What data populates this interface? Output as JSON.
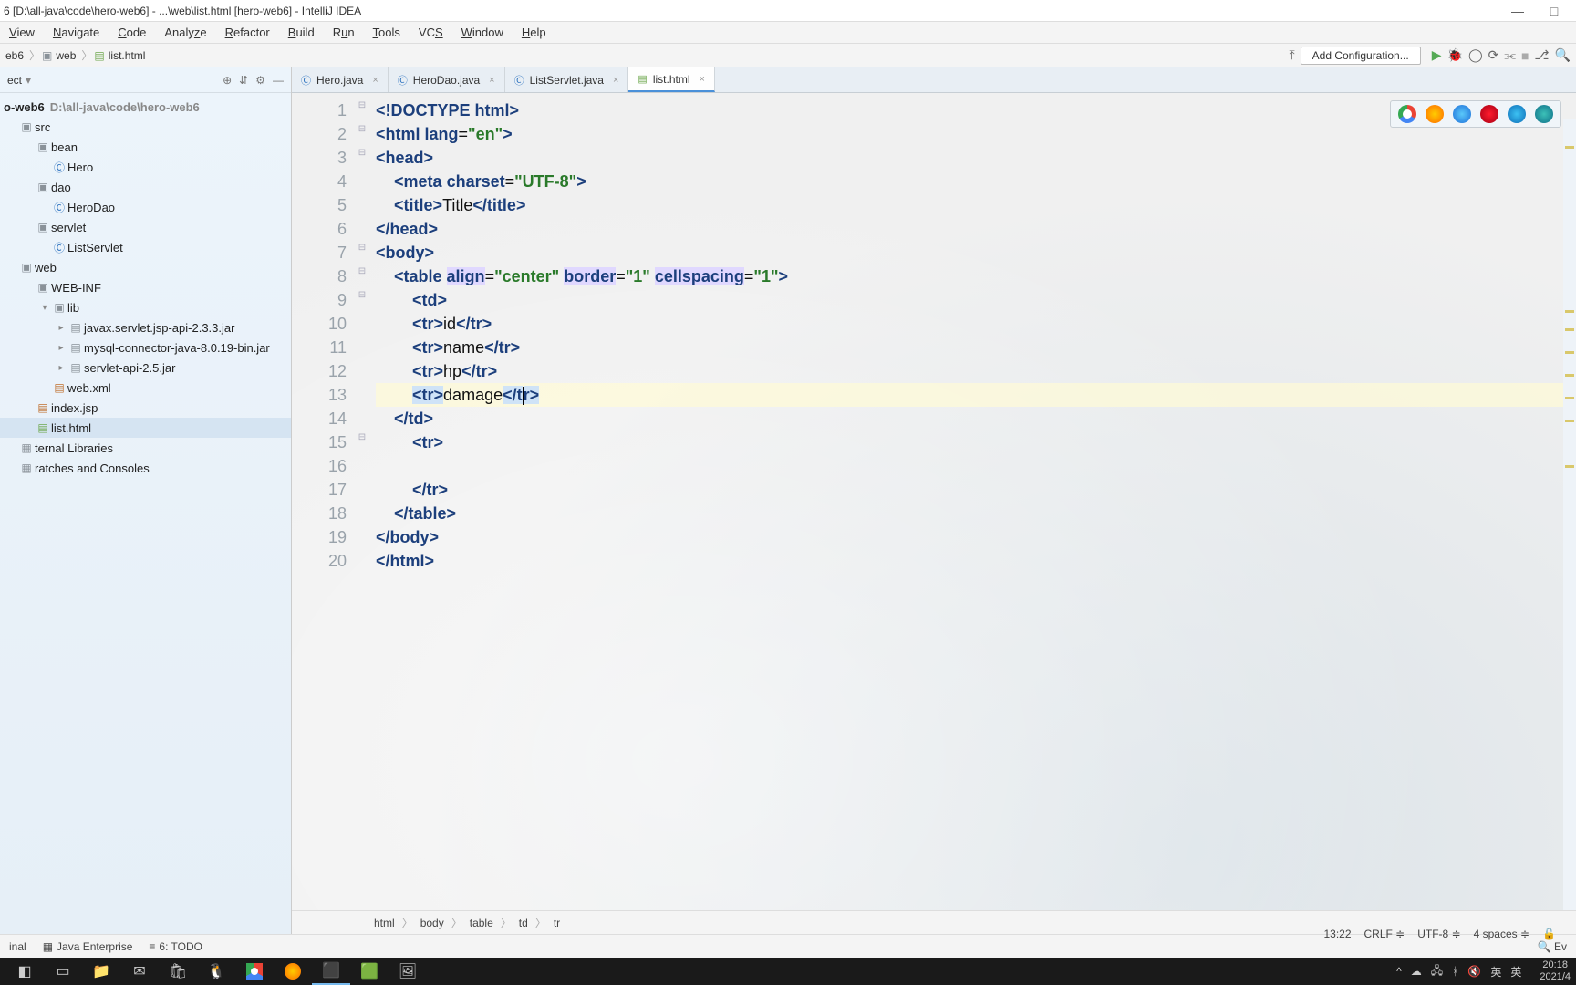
{
  "window": {
    "title": "6 [D:\\all-java\\code\\hero-web6] - ...\\web\\list.html [hero-web6] - IntelliJ IDEA"
  },
  "menu": [
    "View",
    "Navigate",
    "Code",
    "Analyze",
    "Refactor",
    "Build",
    "Run",
    "Tools",
    "VCS",
    "Window",
    "Help"
  ],
  "navcrumbs": [
    {
      "label": "eb6",
      "icon": ""
    },
    {
      "label": "web",
      "icon": "folder"
    },
    {
      "label": "list.html",
      "icon": "html"
    }
  ],
  "add_config": "Add Configuration...",
  "sidebar": {
    "header": "ect",
    "project_root": {
      "name": "o-web6",
      "path": "D:\\all-java\\code\\hero-web6"
    },
    "tree": [
      {
        "depth": 0,
        "arrow": "",
        "icon": "folder",
        "label": "src"
      },
      {
        "depth": 1,
        "arrow": "",
        "icon": "folder",
        "label": "bean"
      },
      {
        "depth": 2,
        "arrow": "",
        "icon": "java",
        "label": "Hero"
      },
      {
        "depth": 1,
        "arrow": "",
        "icon": "folder",
        "label": "dao"
      },
      {
        "depth": 2,
        "arrow": "",
        "icon": "java",
        "label": "HeroDao"
      },
      {
        "depth": 1,
        "arrow": "",
        "icon": "folder",
        "label": "servlet"
      },
      {
        "depth": 2,
        "arrow": "",
        "icon": "java",
        "label": "ListServlet"
      },
      {
        "depth": 0,
        "arrow": "",
        "icon": "folder",
        "label": "web"
      },
      {
        "depth": 1,
        "arrow": "",
        "icon": "folder",
        "label": "WEB-INF"
      },
      {
        "depth": 2,
        "arrow": "▾",
        "icon": "folder",
        "label": "lib"
      },
      {
        "depth": 3,
        "arrow": "▸",
        "icon": "jar",
        "label": "javax.servlet.jsp-api-2.3.3.jar"
      },
      {
        "depth": 3,
        "arrow": "▸",
        "icon": "jar",
        "label": "mysql-connector-java-8.0.19-bin.jar"
      },
      {
        "depth": 3,
        "arrow": "▸",
        "icon": "jar",
        "label": "servlet-api-2.5.jar"
      },
      {
        "depth": 2,
        "arrow": "",
        "icon": "xml",
        "label": "web.xml"
      },
      {
        "depth": 1,
        "arrow": "",
        "icon": "jsp",
        "label": "index.jsp"
      },
      {
        "depth": 1,
        "arrow": "",
        "icon": "html",
        "label": "list.html",
        "selected": true
      },
      {
        "depth": 0,
        "arrow": "",
        "icon": "lib",
        "label": "ternal Libraries"
      },
      {
        "depth": 0,
        "arrow": "",
        "icon": "scratch",
        "label": "ratches and Consoles"
      }
    ]
  },
  "tabs": [
    {
      "icon": "java",
      "label": "Hero.java",
      "active": false
    },
    {
      "icon": "java",
      "label": "HeroDao.java",
      "active": false
    },
    {
      "icon": "java",
      "label": "ListServlet.java",
      "active": false
    },
    {
      "icon": "html",
      "label": "list.html",
      "active": true
    }
  ],
  "code": {
    "lines": [
      {
        "n": 1,
        "tokens": [
          {
            "t": "<!",
            "c": "tag"
          },
          {
            "t": "DOCTYPE ",
            "c": "tag"
          },
          {
            "t": "html",
            "c": "attr"
          },
          {
            "t": ">",
            "c": "tag"
          }
        ]
      },
      {
        "n": 2,
        "tokens": [
          {
            "t": "<",
            "c": "tag"
          },
          {
            "t": "html ",
            "c": "tag"
          },
          {
            "t": "lang",
            "c": "attr"
          },
          {
            "t": "=",
            "c": "txt"
          },
          {
            "t": "\"en\"",
            "c": "str"
          },
          {
            "t": ">",
            "c": "tag"
          }
        ]
      },
      {
        "n": 3,
        "tokens": [
          {
            "t": "<",
            "c": "tag"
          },
          {
            "t": "head",
            "c": "tag"
          },
          {
            "t": ">",
            "c": "tag"
          }
        ]
      },
      {
        "n": 4,
        "indent": 1,
        "tokens": [
          {
            "t": "<",
            "c": "tag"
          },
          {
            "t": "meta ",
            "c": "tag"
          },
          {
            "t": "charset",
            "c": "attr"
          },
          {
            "t": "=",
            "c": "txt"
          },
          {
            "t": "\"UTF-8\"",
            "c": "str"
          },
          {
            "t": ">",
            "c": "tag"
          }
        ]
      },
      {
        "n": 5,
        "indent": 1,
        "tokens": [
          {
            "t": "<",
            "c": "tag"
          },
          {
            "t": "title",
            "c": "tag"
          },
          {
            "t": ">",
            "c": "tag"
          },
          {
            "t": "Title",
            "c": "txt"
          },
          {
            "t": "</",
            "c": "tag"
          },
          {
            "t": "title",
            "c": "tag"
          },
          {
            "t": ">",
            "c": "tag"
          }
        ]
      },
      {
        "n": 6,
        "tokens": [
          {
            "t": "</",
            "c": "tag"
          },
          {
            "t": "head",
            "c": "tag"
          },
          {
            "t": ">",
            "c": "tag"
          }
        ]
      },
      {
        "n": 7,
        "tokens": [
          {
            "t": "<",
            "c": "tag"
          },
          {
            "t": "body",
            "c": "tag"
          },
          {
            "t": ">",
            "c": "tag"
          }
        ]
      },
      {
        "n": 8,
        "indent": 1,
        "tokens": [
          {
            "t": "<",
            "c": "tag"
          },
          {
            "t": "table ",
            "c": "tag"
          },
          {
            "t": "align",
            "c": "attr attr-hl"
          },
          {
            "t": "=",
            "c": "txt"
          },
          {
            "t": "\"center\"",
            "c": "str"
          },
          {
            "t": " ",
            "c": "txt"
          },
          {
            "t": "border",
            "c": "attr attr-hl"
          },
          {
            "t": "=",
            "c": "txt"
          },
          {
            "t": "\"1\"",
            "c": "str"
          },
          {
            "t": " ",
            "c": "txt"
          },
          {
            "t": "cellspacing",
            "c": "attr attr-hl"
          },
          {
            "t": "=",
            "c": "txt"
          },
          {
            "t": "\"1\"",
            "c": "str"
          },
          {
            "t": ">",
            "c": "tag"
          }
        ]
      },
      {
        "n": 9,
        "indent": 2,
        "tokens": [
          {
            "t": "<",
            "c": "tag"
          },
          {
            "t": "td",
            "c": "tag"
          },
          {
            "t": ">",
            "c": "tag"
          }
        ]
      },
      {
        "n": 10,
        "indent": 2,
        "tokens": [
          {
            "t": "<",
            "c": "tag"
          },
          {
            "t": "tr",
            "c": "tag"
          },
          {
            "t": ">",
            "c": "tag"
          },
          {
            "t": "id",
            "c": "txt"
          },
          {
            "t": "</",
            "c": "tag"
          },
          {
            "t": "tr",
            "c": "tag"
          },
          {
            "t": ">",
            "c": "tag"
          }
        ]
      },
      {
        "n": 11,
        "indent": 2,
        "tokens": [
          {
            "t": "<",
            "c": "tag"
          },
          {
            "t": "tr",
            "c": "tag"
          },
          {
            "t": ">",
            "c": "tag"
          },
          {
            "t": "name",
            "c": "txt"
          },
          {
            "t": "</",
            "c": "tag"
          },
          {
            "t": "tr",
            "c": "tag"
          },
          {
            "t": ">",
            "c": "tag"
          }
        ]
      },
      {
        "n": 12,
        "indent": 2,
        "tokens": [
          {
            "t": "<",
            "c": "tag"
          },
          {
            "t": "tr",
            "c": "tag"
          },
          {
            "t": ">",
            "c": "tag"
          },
          {
            "t": "hp",
            "c": "txt"
          },
          {
            "t": "</",
            "c": "tag"
          },
          {
            "t": "tr",
            "c": "tag"
          },
          {
            "t": ">",
            "c": "tag"
          }
        ]
      },
      {
        "n": 13,
        "indent": 2,
        "hl": true,
        "tokens": [
          {
            "t": "<",
            "c": "tag sel-tag"
          },
          {
            "t": "tr",
            "c": "tag sel-tag"
          },
          {
            "t": ">",
            "c": "tag sel-tag"
          },
          {
            "t": "damage",
            "c": "txt"
          },
          {
            "t": "</",
            "c": "tag sel-tag"
          },
          {
            "t": "t",
            "c": "tag sel-tag"
          },
          {
            "t": "|",
            "c": "caret-marker"
          },
          {
            "t": "r",
            "c": "tag sel-tag"
          },
          {
            "t": ">",
            "c": "tag sel-tag"
          }
        ]
      },
      {
        "n": 14,
        "indent": 1,
        "tokens": [
          {
            "t": "</",
            "c": "tag"
          },
          {
            "t": "td",
            "c": "tag"
          },
          {
            "t": ">",
            "c": "tag"
          }
        ]
      },
      {
        "n": 15,
        "indent": 2,
        "tokens": [
          {
            "t": "<",
            "c": "tag"
          },
          {
            "t": "tr",
            "c": "tag"
          },
          {
            "t": ">",
            "c": "tag"
          }
        ]
      },
      {
        "n": 16,
        "tokens": []
      },
      {
        "n": 17,
        "indent": 2,
        "tokens": [
          {
            "t": "</",
            "c": "tag"
          },
          {
            "t": "tr",
            "c": "tag"
          },
          {
            "t": ">",
            "c": "tag"
          }
        ]
      },
      {
        "n": 18,
        "indent": 1,
        "tokens": [
          {
            "t": "</",
            "c": "tag"
          },
          {
            "t": "table",
            "c": "tag"
          },
          {
            "t": ">",
            "c": "tag"
          }
        ]
      },
      {
        "n": 19,
        "tokens": [
          {
            "t": "</",
            "c": "tag"
          },
          {
            "t": "body",
            "c": "tag"
          },
          {
            "t": ">",
            "c": "tag"
          }
        ]
      },
      {
        "n": 20,
        "tokens": [
          {
            "t": "</",
            "c": "tag"
          },
          {
            "t": "html",
            "c": "tag"
          },
          {
            "t": ">",
            "c": "tag"
          }
        ]
      }
    ]
  },
  "breadcrumb_path": [
    "html",
    "body",
    "table",
    "td",
    "tr"
  ],
  "bottom_tools": {
    "terminal": "inal",
    "java_ee": "Java Enterprise",
    "todo": "6: TODO",
    "event": "Ev"
  },
  "status": {
    "pos": "13:22",
    "lineend": "CRLF",
    "enc": "UTF-8",
    "indent": "4 spaces"
  },
  "taskbar": {
    "time": "20:18",
    "date": "2021/4",
    "ime": "英",
    "ime2": "英"
  }
}
